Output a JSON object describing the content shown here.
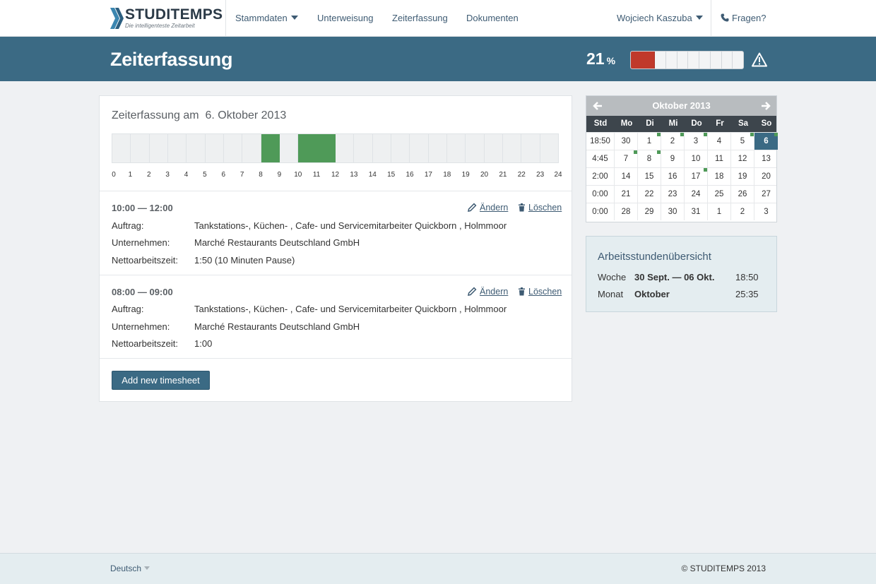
{
  "brand": {
    "name": "STUDITEMPS",
    "tagline": "Die intelligenteste Zeitarbeit"
  },
  "nav": {
    "items": [
      {
        "label": "Stammdaten",
        "dropdown": true
      },
      {
        "label": "Unterweisung"
      },
      {
        "label": "Zeiterfassung"
      },
      {
        "label": "Dokumenten"
      }
    ],
    "user": "Wojciech Kaszuba",
    "help": "Fragen?"
  },
  "header": {
    "title": "Zeiterfassung",
    "progress_value": "21",
    "progress_unit": "%",
    "progress_fraction": 0.21,
    "progress_color": "#c0392b"
  },
  "day": {
    "title_prefix": "Zeiterfassung am",
    "date": "6. Oktober 2013",
    "hour_ticks": [
      "0",
      "1",
      "2",
      "3",
      "4",
      "5",
      "6",
      "7",
      "8",
      "9",
      "10",
      "11",
      "12",
      "13",
      "14",
      "15",
      "16",
      "17",
      "18",
      "19",
      "20",
      "21",
      "22",
      "23",
      "24"
    ],
    "worked_hours": [
      8,
      10,
      11
    ],
    "worked_color": "#4f9a58"
  },
  "entries": [
    {
      "time": "10:00 — 12:00",
      "edit_label": "Ändern",
      "delete_label": "Löschen",
      "rows": [
        {
          "label": "Auftrag:",
          "value": "Tankstations-, Küchen- , Cafe- und Servicemitarbeiter Quickborn , Holmmoor"
        },
        {
          "label": "Unternehmen:",
          "value": "Marché Restaurants Deutschland GmbH"
        },
        {
          "label": "Nettoarbeitszeit:",
          "value": "1:50  (10 Minuten Pause)"
        }
      ]
    },
    {
      "time": "08:00 — 09:00",
      "edit_label": "Ändern",
      "delete_label": "Löschen",
      "rows": [
        {
          "label": "Auftrag:",
          "value": "Tankstations-, Küchen- , Cafe- und Servicemitarbeiter Quickborn , Holmmoor"
        },
        {
          "label": "Unternehmen:",
          "value": "Marché Restaurants Deutschland GmbH"
        },
        {
          "label": "Nettoarbeitszeit:",
          "value": "1:00"
        }
      ]
    }
  ],
  "add_button": "Add new timesheet",
  "calendar": {
    "month": "Oktober 2013",
    "std_header": "Std",
    "weekdays": [
      "Mo",
      "Di",
      "Mi",
      "Do",
      "Fr",
      "Sa",
      "So"
    ],
    "weeks": [
      {
        "std": "18:50",
        "days": [
          "30",
          "1",
          "2",
          "3",
          "4",
          "5",
          "6"
        ],
        "marked": [
          1,
          2,
          3,
          5,
          6
        ],
        "today": 6
      },
      {
        "std": "4:45",
        "days": [
          "7",
          "8",
          "9",
          "10",
          "11",
          "12",
          "13"
        ],
        "marked": [
          0,
          1
        ],
        "today": -1
      },
      {
        "std": "2:00",
        "days": [
          "14",
          "15",
          "16",
          "17",
          "18",
          "19",
          "20"
        ],
        "marked": [
          3
        ],
        "today": -1
      },
      {
        "std": "0:00",
        "days": [
          "21",
          "22",
          "23",
          "24",
          "25",
          "26",
          "27"
        ],
        "marked": [],
        "today": -1
      },
      {
        "std": "0:00",
        "days": [
          "28",
          "29",
          "30",
          "31",
          "1",
          "2",
          "3"
        ],
        "marked": [],
        "today": -1
      }
    ]
  },
  "summary": {
    "title": "Arbeitsstundenübersicht",
    "rows": [
      {
        "label": "Woche",
        "range": "30 Sept. — 06 Okt.",
        "value": "18:50"
      },
      {
        "label": "Monat",
        "range": "Oktober",
        "value": "25:35"
      }
    ]
  },
  "footer": {
    "language": "Deutsch",
    "copyright": "© STUDITEMPS 2013"
  }
}
